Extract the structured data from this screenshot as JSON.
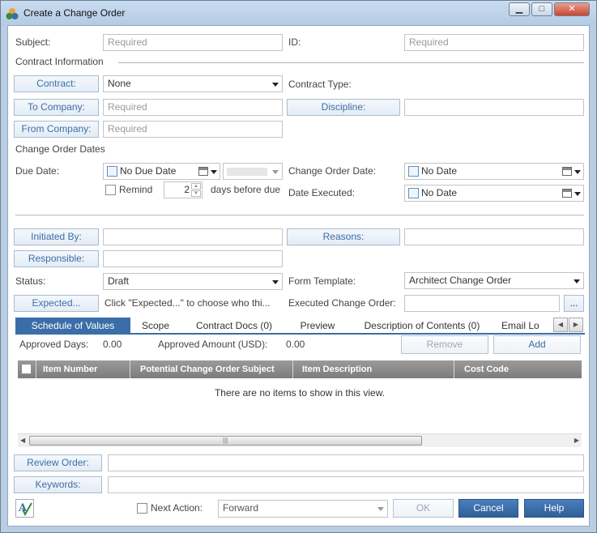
{
  "window": {
    "title": "Create a Change Order",
    "controls": {
      "minimize": "▁",
      "maximize": "□",
      "close": "✕"
    }
  },
  "form": {
    "subject_label": "Subject:",
    "subject_placeholder": "Required",
    "id_label": "ID:",
    "id_placeholder": "Required",
    "contract_info_heading": "Contract Information",
    "contract_button": "Contract:",
    "contract_value": "None",
    "contract_type_label": "Contract Type:",
    "to_company_button": "To Company:",
    "to_company_placeholder": "Required",
    "discipline_button": "Discipline:",
    "from_company_button": "From Company:",
    "from_company_placeholder": "Required",
    "dates_heading": "Change Order Dates",
    "due_date_label": "Due Date:",
    "due_date_value": "No Due Date",
    "remind_label": "Remind",
    "remind_days": "2",
    "days_before_due": "days before due",
    "change_order_date_label": "Change Order Date:",
    "change_order_date_value": "No Date",
    "date_executed_label": "Date Executed:",
    "date_executed_value": "No Date",
    "initiated_by_button": "Initiated By:",
    "reasons_button": "Reasons:",
    "responsible_button": "Responsible:",
    "status_label": "Status:",
    "status_value": "Draft",
    "form_template_label": "Form Template:",
    "form_template_value": "Architect Change Order",
    "expected_button": "Expected...",
    "expected_hint": "Click \"Expected...\" to choose who thi...",
    "executed_change_order_label": "Executed Change Order:",
    "browse_button": "..."
  },
  "tabs": [
    {
      "label": "Schedule of Values",
      "active": true
    },
    {
      "label": "Scope",
      "active": false
    },
    {
      "label": "Contract Docs (0)",
      "active": false
    },
    {
      "label": "Preview",
      "active": false
    },
    {
      "label": "Description of Contents (0)",
      "active": false
    },
    {
      "label": "Email Lo",
      "active": false
    }
  ],
  "sov": {
    "approved_days_label": "Approved Days:",
    "approved_days_value": "0.00",
    "approved_amount_label": "Approved Amount (USD):",
    "approved_amount_value": "0.00",
    "remove_button": "Remove",
    "add_button": "Add",
    "columns": [
      "Item Number",
      "Potential Change Order Subject",
      "Item Description",
      "Cost Code"
    ],
    "empty_message": "There are no items to show in this view."
  },
  "bottom": {
    "review_order_button": "Review Order:",
    "keywords_button": "Keywords:",
    "spellcheck_icon": "spellcheck-icon",
    "next_action_label": "Next Action:",
    "next_action_value": "Forward",
    "ok_button": "OK",
    "cancel_button": "Cancel",
    "help_button": "Help"
  },
  "colors": {
    "accent": "#3b6ea8",
    "link_text": "#3d6ea8",
    "window_frame": "#b9cde3"
  }
}
